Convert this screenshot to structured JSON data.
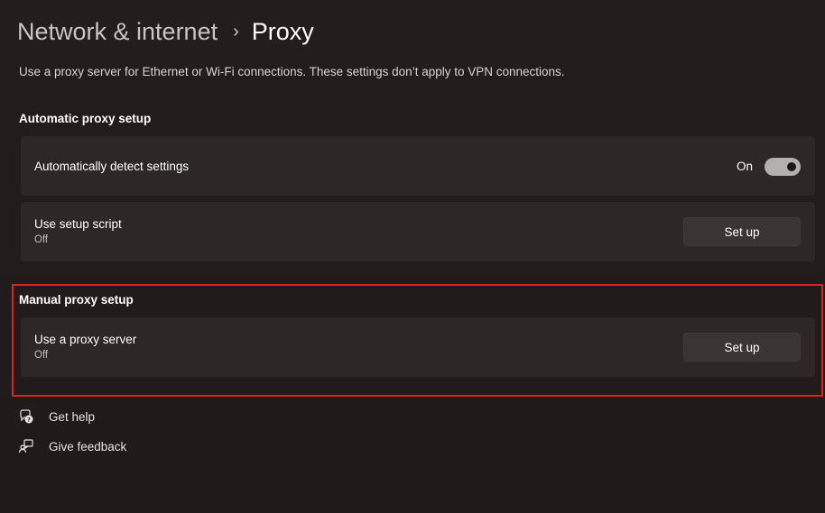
{
  "breadcrumb": {
    "parent": "Network & internet",
    "separator": "›",
    "current": "Proxy"
  },
  "description": "Use a proxy server for Ethernet or Wi-Fi connections. These settings don’t apply to VPN connections.",
  "automatic": {
    "section_title": "Automatic proxy setup",
    "detect": {
      "title": "Automatically detect settings",
      "toggle_label": "On",
      "toggle_state": true
    },
    "script": {
      "title": "Use setup script",
      "status": "Off",
      "button": "Set up"
    }
  },
  "manual": {
    "section_title": "Manual proxy setup",
    "proxy": {
      "title": "Use a proxy server",
      "status": "Off",
      "button": "Set up"
    }
  },
  "links": {
    "help": "Get help",
    "feedback": "Give feedback"
  },
  "colors": {
    "background": "#221c1c",
    "card": "#2d2727",
    "highlight": "#d9231f",
    "toggle_on": "#b5b0b0"
  },
  "icons": {
    "help": "help-chat-icon",
    "feedback": "feedback-icon"
  }
}
